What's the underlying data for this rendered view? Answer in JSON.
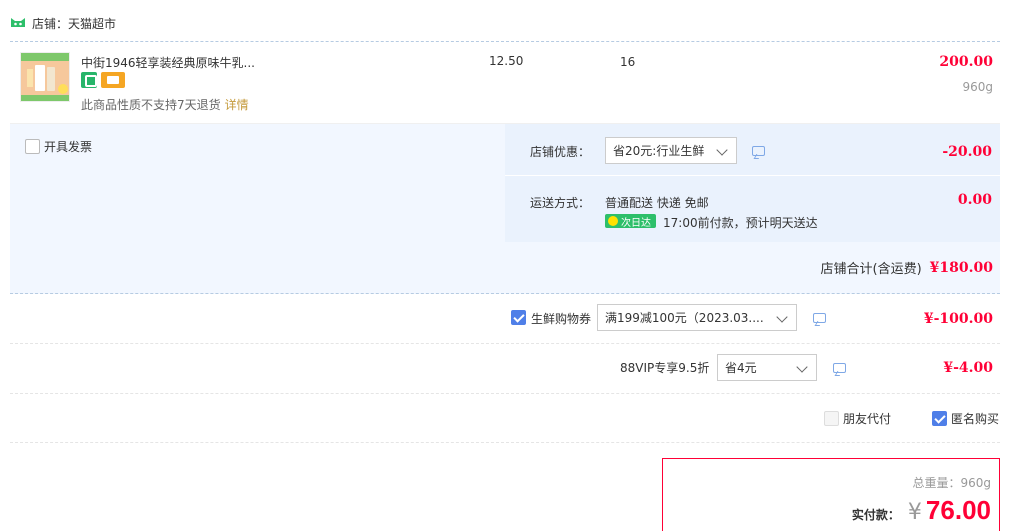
{
  "shop": {
    "label": "店铺：天猫超市",
    "logo_icon": "tmall-cat-icon"
  },
  "item": {
    "title": "中街1946轻享装经典原味牛乳...",
    "note": "此商品性质不支持7天退货",
    "detail_link": "详情",
    "unit_price": "12.50",
    "quantity": "16",
    "subtotal": "200.00",
    "weight": "960g"
  },
  "order": {
    "invoice_label": "开具发票",
    "discount_label": "店铺优惠：",
    "discount_select": "省20元:行业生鲜",
    "discount_amount": "-20.00",
    "shipping_label": "运送方式：",
    "shipping_method": "普通配送 快递 免邮",
    "shipping_tag": "次日达",
    "shipping_desc": "17:00前付款，预计明天送达",
    "shipping_amount": "0.00",
    "shop_total_label": "店铺合计(含运费)",
    "shop_total_value": "¥180.00"
  },
  "coupon": {
    "label": "生鲜购物券",
    "checked": true,
    "select": "满199减100元（2023.03....",
    "amount": "¥-100.00"
  },
  "vip": {
    "label": "88VIP专享9.5折",
    "select": "省4元",
    "amount": "¥-4.00"
  },
  "options": {
    "friend_pay": "朋友代付",
    "anonymous": "匿名购买"
  },
  "pay": {
    "total_weight": "总重量：960g",
    "actual_label": "实付款：",
    "currency": "¥",
    "amount": "76.00"
  },
  "colors": {
    "price_red": "#ff0036",
    "panel_blue": "#f2f7ff",
    "check_blue": "#4f7fe8",
    "tag_green": "#2dbf6a"
  }
}
